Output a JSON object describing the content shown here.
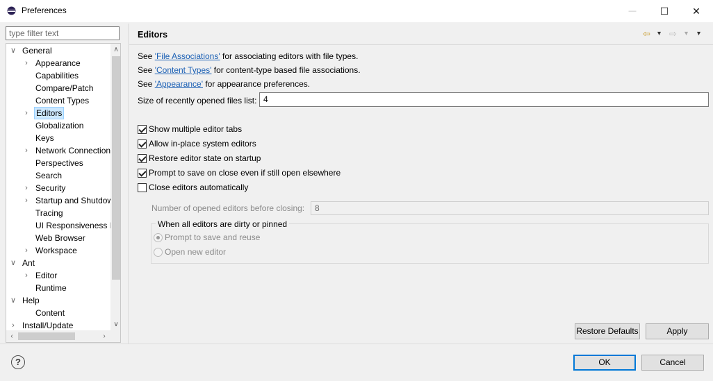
{
  "window": {
    "title": "Preferences",
    "minimize_glyph": "—",
    "maximize_glyph": "☐",
    "close_glyph": "✕"
  },
  "filter": {
    "placeholder": "type filter text",
    "value": ""
  },
  "tree": [
    {
      "label": "General",
      "expander": "∨"
    },
    {
      "label": "Appearance",
      "expander": "›"
    },
    {
      "label": "Capabilities"
    },
    {
      "label": "Compare/Patch"
    },
    {
      "label": "Content Types"
    },
    {
      "label": "Editors",
      "expander": "›",
      "selected": true
    },
    {
      "label": "Globalization"
    },
    {
      "label": "Keys"
    },
    {
      "label": "Network Connection",
      "expander": "›"
    },
    {
      "label": "Perspectives"
    },
    {
      "label": "Search"
    },
    {
      "label": "Security",
      "expander": "›"
    },
    {
      "label": "Startup and Shutdow",
      "expander": "›"
    },
    {
      "label": "Tracing"
    },
    {
      "label": "UI Responsiveness M"
    },
    {
      "label": "Web Browser"
    },
    {
      "label": "Workspace",
      "expander": "›"
    },
    {
      "label": "Ant",
      "expander": "∨"
    },
    {
      "label": "Editor",
      "expander": "›"
    },
    {
      "label": "Runtime"
    },
    {
      "label": "Help",
      "expander": "∨"
    },
    {
      "label": "Content"
    },
    {
      "label": "Install/Update",
      "expander": "›"
    }
  ],
  "scroll": {
    "up": "∧",
    "down": "∨",
    "left": "‹",
    "right": "›"
  },
  "page": {
    "title": "Editors",
    "nav": {
      "back": "⇦",
      "back_menu": "▾",
      "forward": "⇨",
      "forward_menu": "▾",
      "view_menu": "▾"
    },
    "links": [
      {
        "prefix": "See ",
        "link": "'File Associations'",
        "suffix": " for associating editors with file types."
      },
      {
        "prefix": "See ",
        "link": "'Content Types'",
        "suffix": " for content-type based file associations."
      },
      {
        "prefix": "See ",
        "link": "'Appearance'",
        "suffix": " for appearance preferences."
      }
    ],
    "size_label": "Size of recently opened files list:",
    "size_value": "4",
    "checkboxes": [
      {
        "label": "Show multiple editor tabs",
        "checked": true
      },
      {
        "label": "Allow in-place system editors",
        "checked": true
      },
      {
        "label": "Restore editor state on startup",
        "checked": true
      },
      {
        "label": "Prompt to save on close even if still open elsewhere",
        "checked": true
      },
      {
        "label": "Close editors automatically",
        "checked": false
      }
    ],
    "num_label": "Number of opened editors before closing:",
    "num_value": "8",
    "group_title": "When all editors are dirty or pinned",
    "radios": [
      {
        "label": "Prompt to save and reuse",
        "selected": true
      },
      {
        "label": "Open new editor",
        "selected": false
      }
    ],
    "restore_defaults": "Restore Defaults",
    "apply": "Apply"
  },
  "footer": {
    "help": "?",
    "ok": "OK",
    "cancel": "Cancel"
  },
  "colors": {
    "link": "#1a5fb4",
    "selection": "#cce8ff",
    "accent": "#0078d7"
  }
}
